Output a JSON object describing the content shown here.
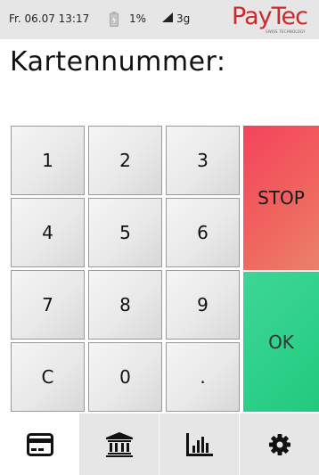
{
  "status": {
    "datetime": "Fr. 06.07 13:17",
    "battery": "1%",
    "network": "3g"
  },
  "logo": {
    "text": "PayTec",
    "subtext": "SWISS TECHNOLOGY"
  },
  "title": "Kartennummer:",
  "keypad": {
    "keys": [
      "1",
      "2",
      "3",
      "4",
      "5",
      "6",
      "7",
      "8",
      "9",
      "C",
      "0",
      "."
    ],
    "stop_label": "STOP",
    "ok_label": "OK"
  },
  "nav": {
    "tabs": [
      {
        "icon": "credit-card-icon",
        "active": true
      },
      {
        "icon": "bank-icon",
        "active": false
      },
      {
        "icon": "bar-chart-icon",
        "active": false
      },
      {
        "icon": "gear-icon",
        "active": false
      }
    ]
  },
  "colors": {
    "stop": "#f0635e",
    "ok": "#2fd18c",
    "logo": "#cc2a2a"
  }
}
